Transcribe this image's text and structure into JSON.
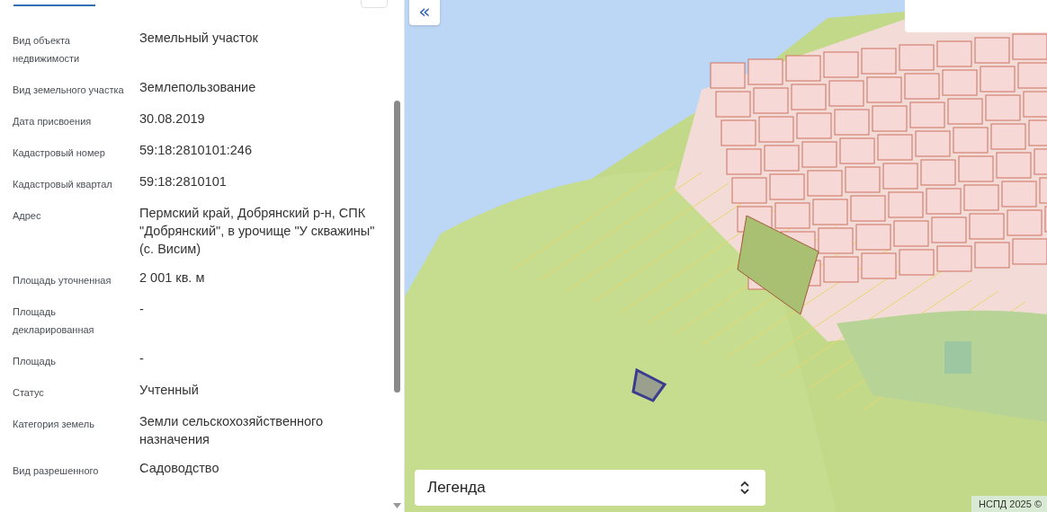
{
  "details": [
    {
      "label": "Вид объекта недвижимости",
      "value": "Земельный участок"
    },
    {
      "label": "Вид земельного участка",
      "value": "Землепользование"
    },
    {
      "label": "Дата присвоения",
      "value": "30.08.2019"
    },
    {
      "label": "Кадастровый номер",
      "value": "59:18:2810101:246"
    },
    {
      "label": "Кадастровый квартал",
      "value": "59:18:2810101"
    },
    {
      "label": "Адрес",
      "value": "Пермский край, Добрянский р-н, СПК \"Добрянский\", в урочище \"У скважины\" (с. Висим)"
    },
    {
      "label": "Площадь уточненная",
      "value": "2 001 кв. м"
    },
    {
      "label": "Площадь декларированная",
      "value": "-"
    },
    {
      "label": "Площадь",
      "value": "-"
    },
    {
      "label": "Статус",
      "value": "Учтенный"
    },
    {
      "label": "Категория земель",
      "value": "Земли сельскохозяйственного назначения"
    },
    {
      "label": "Вид разрешенного",
      "value": "Садоводство"
    }
  ],
  "map": {
    "collapse_button": "«",
    "legend": "Легенда",
    "attribution": "НСПД 2025 ©"
  }
}
